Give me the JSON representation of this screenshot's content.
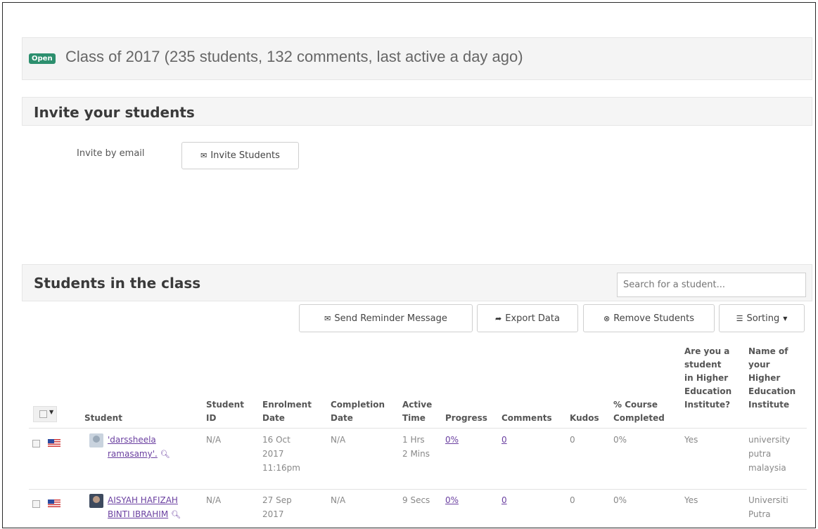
{
  "class_bar": {
    "badge": "Open",
    "title": "Class of 2017 (235 students, 132 comments, last active a day ago)"
  },
  "invite": {
    "heading": "Invite your students",
    "label": "Invite by email",
    "button": "Invite Students"
  },
  "students": {
    "heading": "Students in the class",
    "search_placeholder": "Search for a student...",
    "toolbar": {
      "reminder": "Send Reminder Message",
      "export": "Export Data",
      "remove": "Remove Students",
      "sorting": "Sorting"
    },
    "columns": {
      "student": "Student",
      "student_id": [
        "Student",
        "ID"
      ],
      "enrolment": [
        "Enrolment",
        "Date"
      ],
      "completion": [
        "Completion",
        "Date"
      ],
      "active": [
        "Active",
        "Time"
      ],
      "progress": "Progress",
      "comments": "Comments",
      "kudos": "Kudos",
      "course": [
        "% Course",
        "Completed"
      ],
      "hei": [
        "Are you a",
        "student",
        "in Higher",
        "Education",
        "Institute?"
      ],
      "hei_name": [
        "Name of",
        "your",
        "Higher",
        "Education",
        "Institute"
      ]
    },
    "rows": [
      {
        "name": [
          "'darssheela",
          "ramasamy'."
        ],
        "student_id": "N/A",
        "enrolment": [
          "16 Oct",
          "2017",
          "11:16pm"
        ],
        "completion": "N/A",
        "active": [
          "1 Hrs",
          "2 Mins"
        ],
        "progress": "0%",
        "comments": "0",
        "kudos": "0",
        "course": "0%",
        "hei": "Yes",
        "hei_name": [
          "university",
          "putra",
          "malaysia"
        ]
      },
      {
        "name": [
          "AISYAH HAFIZAH",
          "BINTI IBRAHIM"
        ],
        "student_id": "N/A",
        "enrolment": [
          "27 Sep",
          "2017"
        ],
        "completion": "N/A",
        "active": [
          "9 Secs"
        ],
        "progress": "0%",
        "comments": "0",
        "kudos": "0",
        "course": "0%",
        "hei": "Yes",
        "hei_name": [
          "Universiti",
          "Putra"
        ]
      }
    ]
  },
  "colors": {
    "badge": "#2c8f6e",
    "link": "#6a3fa0"
  }
}
